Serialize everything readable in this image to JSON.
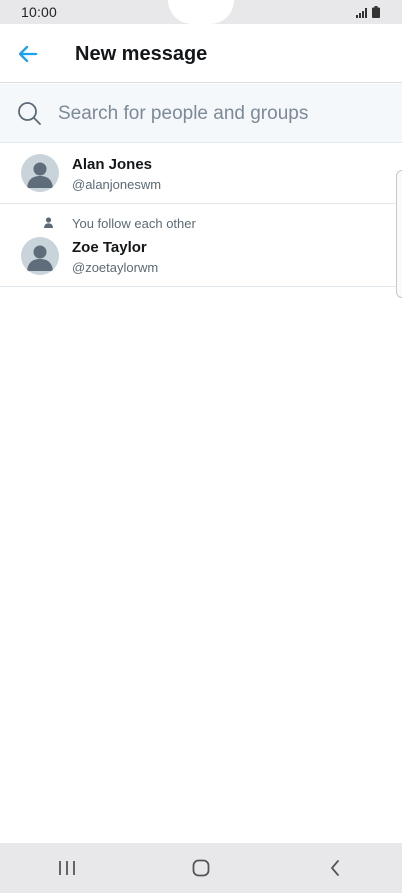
{
  "status_bar": {
    "time": "10:00"
  },
  "header": {
    "title": "New message"
  },
  "search": {
    "placeholder": "Search for people and groups",
    "value": ""
  },
  "contacts": [
    {
      "name": "Alan Jones",
      "handle": "@alanjoneswm",
      "social_context": ""
    },
    {
      "name": "Zoe Taylor",
      "handle": "@zoetaylorwm",
      "social_context": "You follow each other"
    }
  ],
  "colors": {
    "accent": "#1da1f2",
    "secondary_text": "#5b6a76",
    "avatar_bg": "#c9d3da"
  }
}
